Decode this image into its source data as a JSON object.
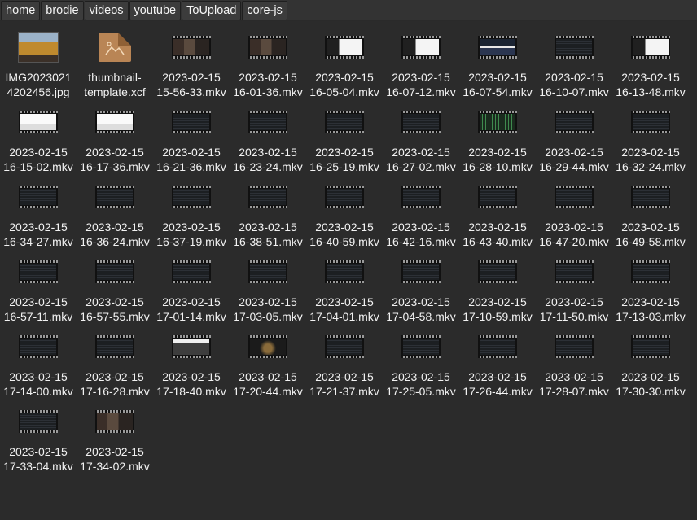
{
  "breadcrumbs": [
    "home",
    "brodie",
    "videos",
    "youtube",
    "ToUpload",
    "core-js"
  ],
  "files": [
    {
      "name": "IMG2023021\n4202456.jpg",
      "kind": "photo"
    },
    {
      "name": "thumbnail-\ntemplate.xcf",
      "kind": "xcf"
    },
    {
      "name": "2023-02-15\n15-56-33.mkv",
      "kind": "person"
    },
    {
      "name": "2023-02-15\n16-01-36.mkv",
      "kind": "person"
    },
    {
      "name": "2023-02-15\n16-05-04.mkv",
      "kind": "core"
    },
    {
      "name": "2023-02-15\n16-07-12.mkv",
      "kind": "core"
    },
    {
      "name": "2023-02-15\n16-07-54.mkv",
      "kind": "blue"
    },
    {
      "name": "2023-02-15\n16-10-07.mkv",
      "kind": "dark-code"
    },
    {
      "name": "2023-02-15\n16-13-48.mkv",
      "kind": "core"
    },
    {
      "name": "2023-02-15\n16-15-02.mkv",
      "kind": "light-doc"
    },
    {
      "name": "2023-02-15\n16-17-36.mkv",
      "kind": "light-doc"
    },
    {
      "name": "2023-02-15\n16-21-36.mkv",
      "kind": "dark-code"
    },
    {
      "name": "2023-02-15\n16-23-24.mkv",
      "kind": "dark-code"
    },
    {
      "name": "2023-02-15\n16-25-19.mkv",
      "kind": "dark-code"
    },
    {
      "name": "2023-02-15\n16-27-02.mkv",
      "kind": "dark-code"
    },
    {
      "name": "2023-02-15\n16-28-10.mkv",
      "kind": "green"
    },
    {
      "name": "2023-02-15\n16-29-44.mkv",
      "kind": "dark-code"
    },
    {
      "name": "2023-02-15\n16-32-24.mkv",
      "kind": "dark-code"
    },
    {
      "name": "2023-02-15\n16-34-27.mkv",
      "kind": "dark-code"
    },
    {
      "name": "2023-02-15\n16-36-24.mkv",
      "kind": "dark-code"
    },
    {
      "name": "2023-02-15\n16-37-19.mkv",
      "kind": "dark-code"
    },
    {
      "name": "2023-02-15\n16-38-51.mkv",
      "kind": "dark-code"
    },
    {
      "name": "2023-02-15\n16-40-59.mkv",
      "kind": "dark-code"
    },
    {
      "name": "2023-02-15\n16-42-16.mkv",
      "kind": "dark-code"
    },
    {
      "name": "2023-02-15\n16-43-40.mkv",
      "kind": "dark-code"
    },
    {
      "name": "2023-02-15\n16-47-20.mkv",
      "kind": "dark-code"
    },
    {
      "name": "2023-02-15\n16-49-58.mkv",
      "kind": "dark-code"
    },
    {
      "name": "2023-02-15\n16-57-11.mkv",
      "kind": "dark-code"
    },
    {
      "name": "2023-02-15\n16-57-55.mkv",
      "kind": "dark-code"
    },
    {
      "name": "2023-02-15\n17-01-14.mkv",
      "kind": "dark-code"
    },
    {
      "name": "2023-02-15\n17-03-05.mkv",
      "kind": "dark-code"
    },
    {
      "name": "2023-02-15\n17-04-01.mkv",
      "kind": "dark-code"
    },
    {
      "name": "2023-02-15\n17-04-58.mkv",
      "kind": "dark-code"
    },
    {
      "name": "2023-02-15\n17-10-59.mkv",
      "kind": "dark-code"
    },
    {
      "name": "2023-02-15\n17-11-50.mkv",
      "kind": "dark-code"
    },
    {
      "name": "2023-02-15\n17-13-03.mkv",
      "kind": "dark-code"
    },
    {
      "name": "2023-02-15\n17-14-00.mkv",
      "kind": "dark-code"
    },
    {
      "name": "2023-02-15\n17-16-28.mkv",
      "kind": "dark-code"
    },
    {
      "name": "2023-02-15\n17-18-40.mkv",
      "kind": "screen"
    },
    {
      "name": "2023-02-15\n17-20-44.mkv",
      "kind": "media"
    },
    {
      "name": "2023-02-15\n17-21-37.mkv",
      "kind": "dark-code"
    },
    {
      "name": "2023-02-15\n17-25-05.mkv",
      "kind": "dark-code"
    },
    {
      "name": "2023-02-15\n17-26-44.mkv",
      "kind": "dark-code"
    },
    {
      "name": "2023-02-15\n17-28-07.mkv",
      "kind": "dark-code"
    },
    {
      "name": "2023-02-15\n17-30-30.mkv",
      "kind": "dark-code"
    },
    {
      "name": "2023-02-15\n17-33-04.mkv",
      "kind": "dark-code"
    },
    {
      "name": "2023-02-15\n17-34-02.mkv",
      "kind": "person"
    }
  ]
}
